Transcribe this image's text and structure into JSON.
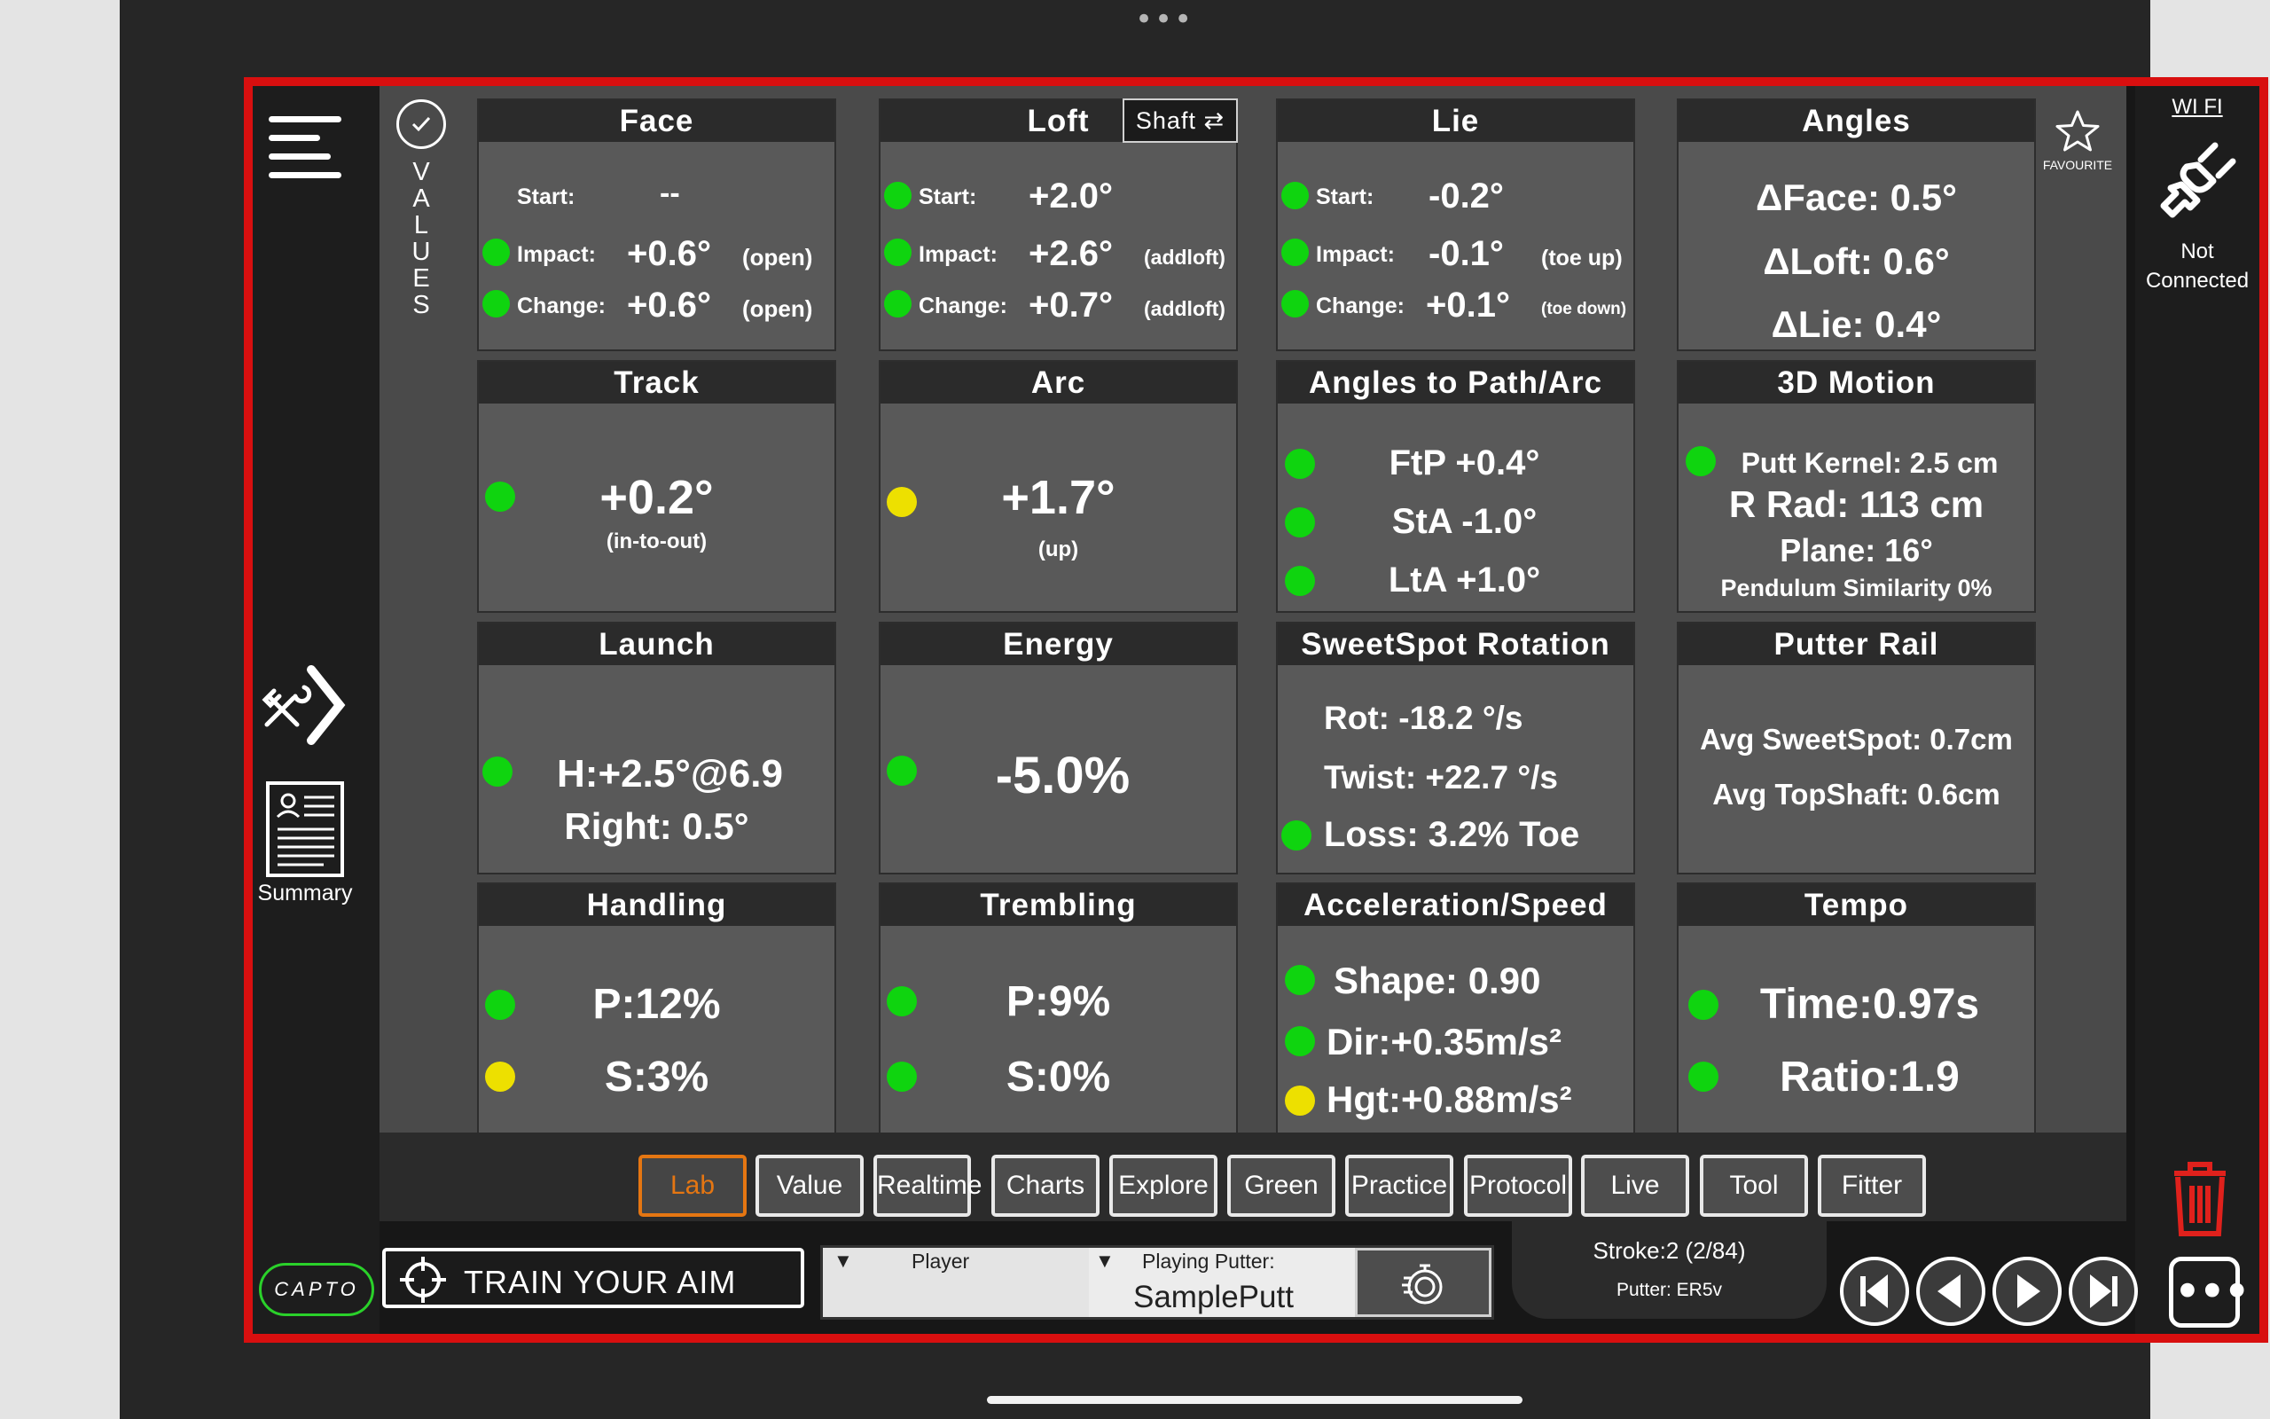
{
  "top_dots": "•••",
  "sidebar": {
    "values_label": "VALUES",
    "summary_label": "Summary"
  },
  "cards": {
    "face": {
      "title": "Face",
      "start_label": "Start:",
      "start_value": "--",
      "impact_label": "Impact:",
      "impact_value": "+0.6°",
      "impact_note": "(open)",
      "change_label": "Change:",
      "change_value": "+0.6°",
      "change_note": "(open)"
    },
    "loft": {
      "title": "Loft",
      "toggle_label": "Shaft",
      "start_label": "Start:",
      "start_value": "+2.0°",
      "impact_label": "Impact:",
      "impact_value": "+2.6°",
      "impact_note": "(addloft)",
      "change_label": "Change:",
      "change_value": "+0.7°",
      "change_note": "(addloft)"
    },
    "lie": {
      "title": "Lie",
      "start_label": "Start:",
      "start_value": "-0.2°",
      "impact_label": "Impact:",
      "impact_value": "-0.1°",
      "impact_note": "(toe up)",
      "change_label": "Change:",
      "change_value": "+0.1°",
      "change_note": "(toe down)"
    },
    "angles": {
      "title": "Angles",
      "face": "ΔFace: 0.5°",
      "loft": "ΔLoft: 0.6°",
      "lie": "ΔLie: 0.4°"
    },
    "track": {
      "title": "Track",
      "value": "+0.2°",
      "note": "(in-to-out)"
    },
    "arc": {
      "title": "Arc",
      "value": "+1.7°",
      "note": "(up)"
    },
    "path": {
      "title": "Angles to Path/Arc",
      "ftp": "FtP +0.4°",
      "sta": "StA -1.0°",
      "lta": "LtA +1.0°"
    },
    "motion": {
      "title": "3D Motion",
      "kernel": "Putt Kernel: 2.5 cm",
      "rrad": "R Rad: 113 cm",
      "plane": "Plane: 16°",
      "pendulum": "Pendulum Similarity 0%"
    },
    "launch": {
      "title": "Launch",
      "h": "H:+2.5°@6.9",
      "right": "Right: 0.5°"
    },
    "energy": {
      "title": "Energy",
      "value": "-5.0%"
    },
    "sweetspot": {
      "title": "SweetSpot Rotation",
      "rot": "Rot: -18.2 °/s",
      "twist": "Twist: +22.7 °/s",
      "loss": "Loss: 3.2% Toe"
    },
    "rail": {
      "title": "Putter Rail",
      "sweet": "Avg SweetSpot: 0.7cm",
      "top": "Avg TopShaft: 0.6cm"
    },
    "handling": {
      "title": "Handling",
      "p": "P:12%",
      "s": "S:3%"
    },
    "trembling": {
      "title": "Trembling",
      "p": "P:9%",
      "s": "S:0%"
    },
    "accel": {
      "title": "Acceleration/Speed",
      "shape": "Shape: 0.90",
      "dir": "Dir:+0.35m/s²",
      "hgt": "Hgt:+0.88m/s²"
    },
    "tempo": {
      "title": "Tempo",
      "time": "Time:0.97s",
      "ratio": "Ratio:1.9"
    }
  },
  "favourite_label": "FAVOURITE",
  "connection": {
    "wifi_label": "WI FI",
    "status": "Not Connected"
  },
  "nav_tabs": [
    "Lab",
    "Value",
    "Realtime",
    "Charts",
    "Explore",
    "Green",
    "Practice",
    "Protocol",
    "Live",
    "Tool",
    "Fitter"
  ],
  "active_tab": "Lab",
  "footer": {
    "logo": "CAPTO",
    "train_label": "TRAIN YOUR AIM",
    "player_label": "Player",
    "putter_label": "Playing Putter:",
    "putter_name": "SamplePutt",
    "stroke": "Stroke:2 (2/84)",
    "putter_model": "Putter: ER5v"
  },
  "colors": {
    "frame": "#d80f0f",
    "green": "#0fd40f",
    "yellow": "#ede000",
    "accent": "#e57612",
    "delete": "#e0211c"
  }
}
